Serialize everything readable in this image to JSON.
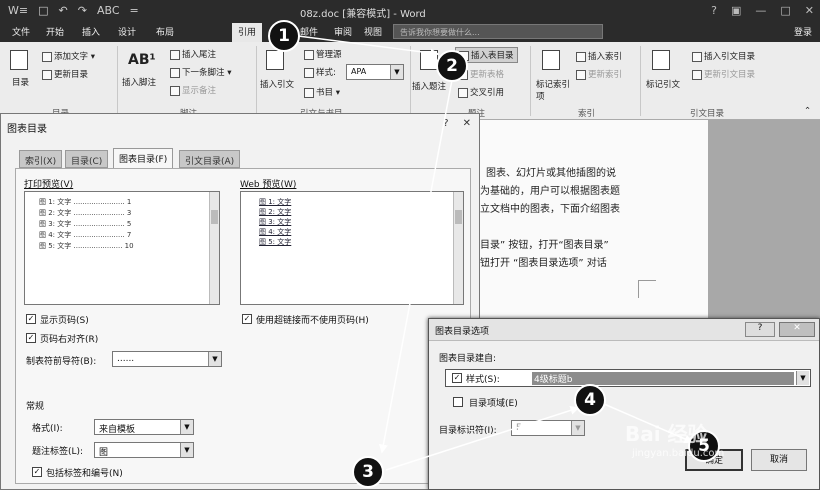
{
  "window": {
    "title": "08z.doc [兼容模式] - Word",
    "qat": [
      "W≡",
      "□",
      "↶",
      "↷",
      "ABC",
      "="
    ],
    "controls": [
      "?",
      "▣",
      "—",
      "□",
      "✕"
    ],
    "login": "登录"
  },
  "ribbon_tabs": [
    "文件",
    "开始",
    "插入",
    "设计",
    "布局",
    "引用",
    "邮件",
    "审阅",
    "视图"
  ],
  "active_tab": "引用",
  "search": {
    "placeholder": "告诉我你想要做什么..."
  },
  "ribbon": {
    "toc": {
      "btn": "目录",
      "add_text": "添加文字 ▾",
      "update": "更新目录",
      "group": "目录"
    },
    "footnote": {
      "insert_footnote": "插入脚注",
      "insert_endnote": "插入尾注",
      "next_footnote": "下一条脚注 ▾",
      "show_notes": "显示备注",
      "group": "脚注"
    },
    "citation": {
      "insert_citation": "插入引文",
      "manage_sources": "管理源",
      "style_label": "样式:",
      "style_value": "APA",
      "bibliography": "书目 ▾",
      "group": "引文与书目"
    },
    "captions": {
      "insert_caption": "插入题注",
      "insert_tof": "插入表目录",
      "update_table": "更新表格",
      "cross_ref": "交叉引用",
      "group": "题注"
    },
    "index": {
      "mark_entry": "标记索引项",
      "insert_index": "插入索引",
      "update_index": "更新索引",
      "group": "索引"
    },
    "toa": {
      "mark_citation": "标记引文",
      "insert_toa": "插入引文目录",
      "update_toa": "更新引文目录",
      "group": "引文目录"
    }
  },
  "document": {
    "lines": [
      "图表、幻灯片或其他插图的说",
      "为基础的，用户可以根据图表题",
      "立文档中的图表，下面介绍图表",
      "",
      "目录” 按钮，打开“图表目录”",
      "钮打开 “图表目录选项” 对话"
    ]
  },
  "tof_dialog": {
    "title": "图表目录",
    "controls": [
      "?",
      "✕"
    ],
    "tabs": [
      "索引(X)",
      "目录(C)",
      "图表目录(F)",
      "引文目录(A)"
    ],
    "active_tab": "图表目录(F)",
    "print_preview_label": "打印预览(V)",
    "print_preview": [
      {
        "label": "图 1: 文字",
        "page": "1"
      },
      {
        "label": "图 2: 文字",
        "page": "3"
      },
      {
        "label": "图 3: 文字",
        "page": "5"
      },
      {
        "label": "图 4: 文字",
        "page": "7"
      },
      {
        "label": "图 5: 文字",
        "page": "10"
      }
    ],
    "web_preview_label": "Web 预览(W)",
    "web_preview": [
      "图 1: 文字",
      "图 2: 文字",
      "图 3: 文字",
      "图 4: 文字",
      "图 5: 文字"
    ],
    "show_page_numbers": "显示页码(S)",
    "right_align": "页码右对齐(R)",
    "tab_leader_label": "制表符前导符(B):",
    "tab_leader_value": "......",
    "use_hyperlinks": "使用超链接而不使用页码(H)",
    "general_label": "常规",
    "format_label": "格式(I):",
    "format_value": "来自模板",
    "caption_label": "题注标签(L):",
    "caption_value": "图",
    "include_label_number": "包括标签和编号(N)"
  },
  "options_dialog": {
    "title": "图表目录选项",
    "controls": [
      "?",
      "✕"
    ],
    "build_from": "图表目录建自:",
    "style_label": "样式(S):",
    "style_value": "4级标题b",
    "table_entry_fields": "目录项域(E)",
    "toc_identifier_label": "目录标识符(I):",
    "toc_identifier_value": "F",
    "ok": "确定",
    "cancel": "取消"
  },
  "annotations": [
    "1",
    "2",
    "3",
    "4",
    "5"
  ],
  "watermark": {
    "brand": "Bai 经验",
    "url": "jingyan.baidu.com"
  }
}
